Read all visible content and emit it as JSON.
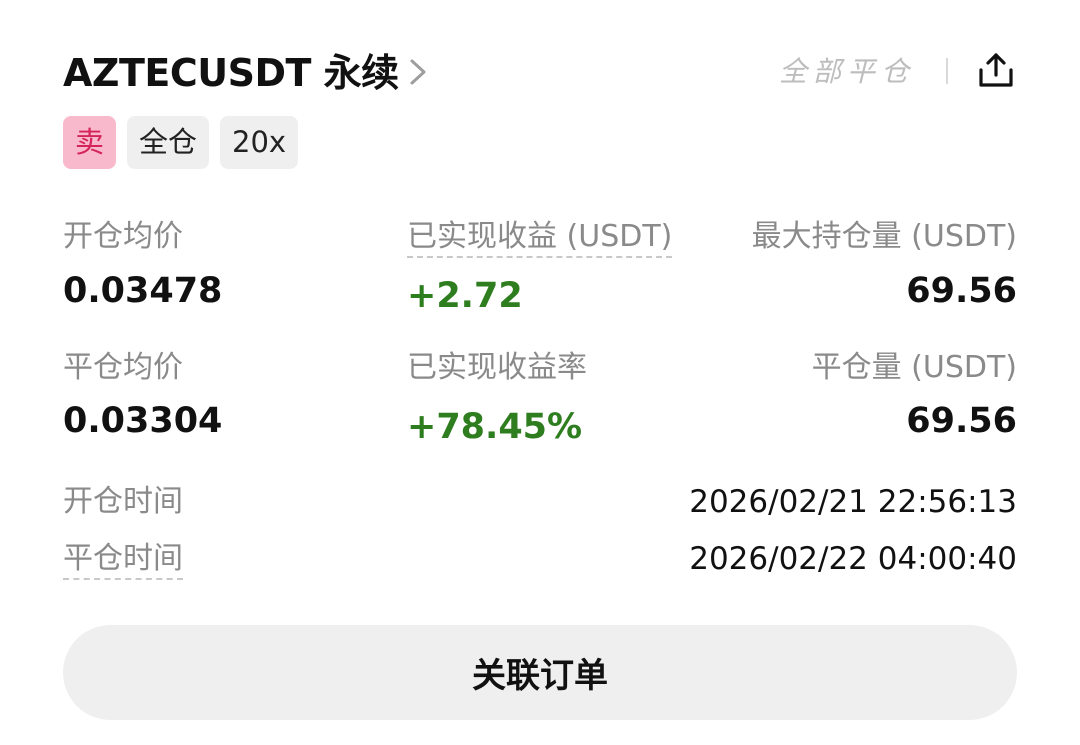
{
  "header": {
    "title": "AZTECUSDT 永续",
    "close_all_label": "全部平仓"
  },
  "tags": {
    "side": "卖",
    "margin_mode": "全仓",
    "leverage": "20x"
  },
  "stats": {
    "open_avg_price_label": "开仓均价",
    "open_avg_price": "0.03478",
    "realized_pnl_label": "已实现收益 (USDT)",
    "realized_pnl": "+2.72",
    "max_position_label": "最大持仓量 (USDT)",
    "max_position": "69.56",
    "close_avg_price_label": "平仓均价",
    "close_avg_price": "0.03304",
    "realized_pnl_rate_label": "已实现收益率",
    "realized_pnl_rate": "+78.45%",
    "close_amount_label": "平仓量 (USDT)",
    "close_amount": "69.56"
  },
  "times": {
    "open_time_label": "开仓时间",
    "open_time": "2026/02/21 22:56:13",
    "close_time_label": "平仓时间",
    "close_time": "2026/02/22 04:00:40"
  },
  "actions": {
    "related_orders_label": "关联订单"
  },
  "colors": {
    "sell_bg": "#f9b9cc",
    "sell_text": "#d4245a",
    "profit_green": "#2e7d1f",
    "muted_label": "#8a8a8a"
  },
  "icons": {
    "chevron": "chevron-right-icon",
    "share": "share-icon"
  }
}
